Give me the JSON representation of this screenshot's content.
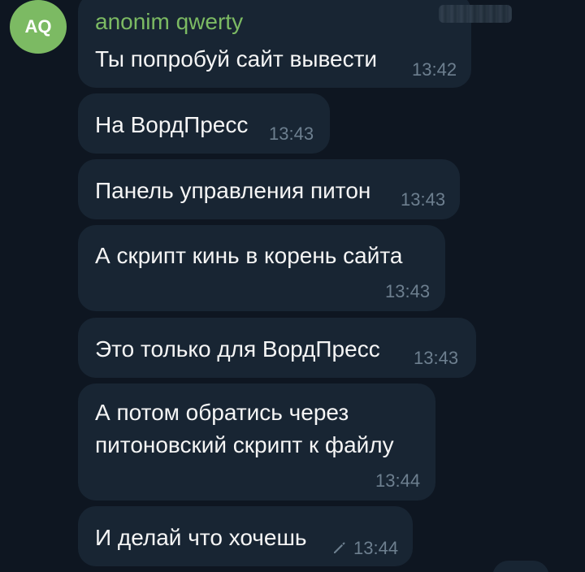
{
  "sender": {
    "initials": "AQ",
    "name": "anonim qwerty"
  },
  "messages": [
    {
      "text": "Ты попробуй сайт вывести",
      "time": "13:42"
    },
    {
      "text": "На ВордПресс",
      "time": "13:43"
    },
    {
      "text": "Панель управления питон",
      "time": "13:43"
    },
    {
      "text": "А скрипт кинь в корень сайта",
      "time": "13:43"
    },
    {
      "text": "Это только для ВордПресс",
      "time": "13:43"
    },
    {
      "lines": [
        "А потом обратись через",
        "питоновский скрипт к файлу"
      ],
      "time": "13:44"
    },
    {
      "text": "И делай что хочешь",
      "time": "13:44",
      "edited_icon": "pencil-icon"
    }
  ],
  "colors": {
    "background": "#0e1621",
    "bubble": "#182533",
    "sender_name": "#7cba63",
    "avatar": "#7cba63",
    "text": "#f5f5f5",
    "time": "#6d7f8f"
  }
}
